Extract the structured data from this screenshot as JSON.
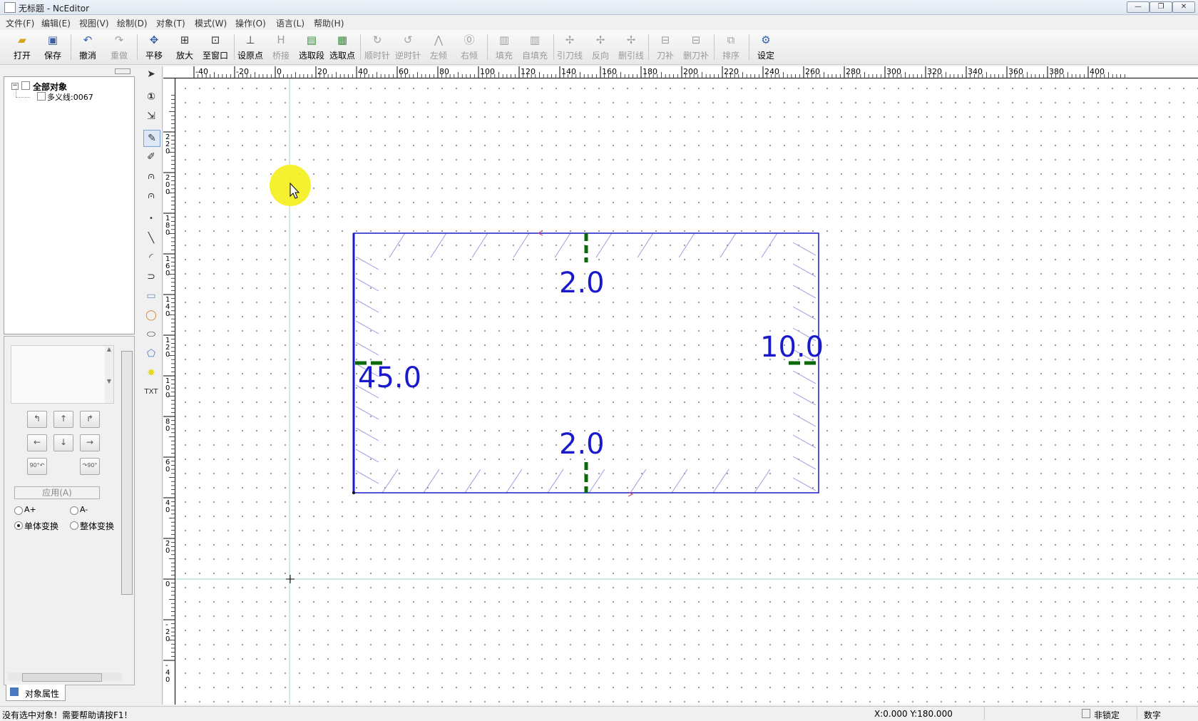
{
  "window": {
    "title": "无标题 - NcEditor"
  },
  "menu": [
    "文件(F)",
    "编辑(E)",
    "视图(V)",
    "绘制(D)",
    "对象(T)",
    "模式(W)",
    "操作(O)",
    "语言(L)",
    "帮助(H)"
  ],
  "toolbar": [
    {
      "label": "打开",
      "icon": "open-folder-icon",
      "enabled": true
    },
    {
      "label": "保存",
      "icon": "save-disk-icon",
      "enabled": true
    },
    {
      "label": "撤消",
      "icon": "undo-icon",
      "enabled": true
    },
    {
      "label": "重做",
      "icon": "redo-icon",
      "enabled": false
    },
    {
      "label": "平移",
      "icon": "pan-icon",
      "enabled": true
    },
    {
      "label": "放大",
      "icon": "zoom-in-icon",
      "enabled": true
    },
    {
      "label": "至窗口",
      "icon": "fit-window-icon",
      "enabled": true
    },
    {
      "label": "设原点",
      "icon": "set-origin-icon",
      "enabled": true
    },
    {
      "label": "桥接",
      "icon": "bridge-icon",
      "enabled": false
    },
    {
      "label": "选取段",
      "icon": "select-segment-icon",
      "enabled": true
    },
    {
      "label": "选取点",
      "icon": "select-point-icon",
      "enabled": true
    },
    {
      "label": "顺时针",
      "icon": "clockwise-icon",
      "enabled": false
    },
    {
      "label": "逆时针",
      "icon": "counterclockwise-icon",
      "enabled": false
    },
    {
      "label": "左倾",
      "icon": "lean-left-icon",
      "enabled": false
    },
    {
      "label": "右倾",
      "icon": "lean-right-icon",
      "enabled": false
    },
    {
      "label": "填充",
      "icon": "fill-icon",
      "enabled": false
    },
    {
      "label": "自填充",
      "icon": "auto-fill-icon",
      "enabled": false
    },
    {
      "label": "引刀线",
      "icon": "lead-line-icon",
      "enabled": false
    },
    {
      "label": "反向",
      "icon": "reverse-icon",
      "enabled": false
    },
    {
      "label": "删引线",
      "icon": "delete-lead-icon",
      "enabled": false
    },
    {
      "label": "刀补",
      "icon": "tool-comp-icon",
      "enabled": false
    },
    {
      "label": "删刀补",
      "icon": "delete-comp-icon",
      "enabled": false
    },
    {
      "label": "排序",
      "icon": "sort-icon",
      "enabled": false
    },
    {
      "label": "设定",
      "icon": "settings-gear-icon",
      "enabled": true
    }
  ],
  "tree": {
    "root": "全部对象",
    "child": "多义线:0067"
  },
  "panel": {
    "apply_label": "应用(A)",
    "radio_a_plus": "A+",
    "radio_a_minus": "A-",
    "radio_single": "单体变换",
    "radio_whole": "整体变换",
    "rotate_ccw": "90°",
    "rotate_cw": "90°",
    "tab_label": "对象属性"
  },
  "ruler": {
    "h_labels": [
      "-40",
      "-20",
      "0",
      "20",
      "40",
      "60",
      "80",
      "100",
      "120",
      "140",
      "160",
      "180",
      "200",
      "220",
      "240",
      "260",
      "280",
      "300",
      "320",
      "340",
      "360",
      "380",
      "400"
    ],
    "v_labels": [
      "220",
      "200",
      "180",
      "160",
      "140",
      "120",
      "100",
      "80",
      "60",
      "40",
      "20",
      "0",
      "-20",
      "-40"
    ]
  },
  "drawing": {
    "dims": [
      "2.0",
      "2.0",
      "45.0",
      "10.0"
    ],
    "rect_color": "#1a1acc",
    "marker_color": "#0a6a0a",
    "highlight_color": "#f5f01a"
  },
  "status": {
    "message": "没有选中对象！需要帮助请按F1！",
    "coords": "X:0.000  Y:180.000",
    "lock": "非锁定",
    "mode": "数字"
  }
}
